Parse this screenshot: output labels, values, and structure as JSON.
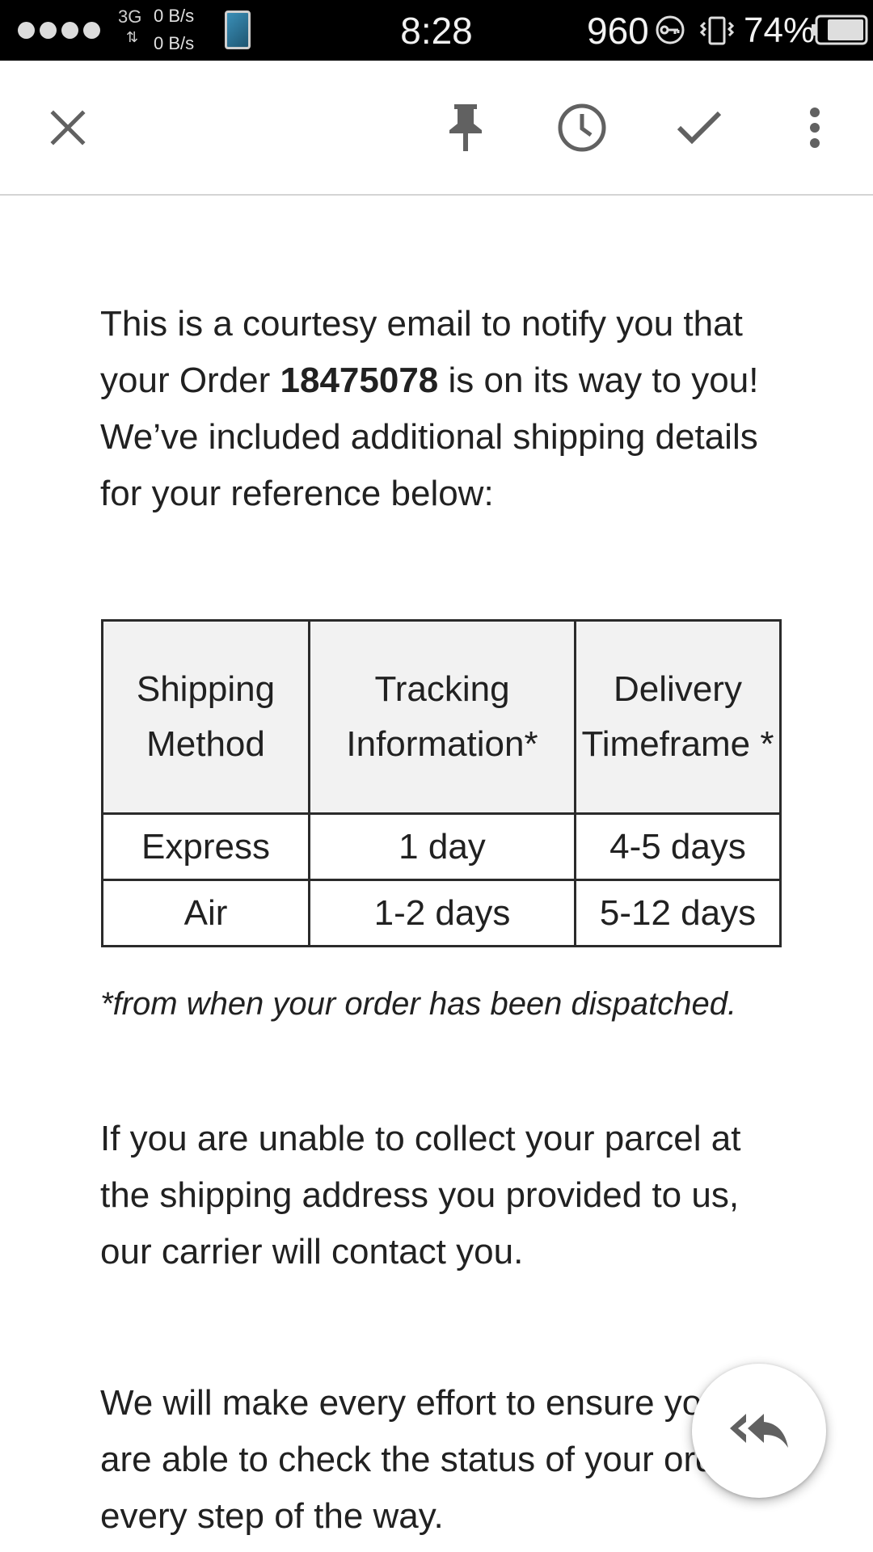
{
  "status_bar": {
    "network_type": "3G",
    "speed_up": "0 B/s",
    "speed_down": "0 B/s",
    "time": "8:28",
    "carrier_number": "960",
    "battery_percent": "74%"
  },
  "toolbar": {
    "close_icon": "close-icon",
    "pin_icon": "pin-icon",
    "snooze_icon": "clock-icon",
    "done_icon": "check-icon",
    "more_icon": "more-vert-icon"
  },
  "email": {
    "intro_part1": "This is a courtesy email to notify you that your Order ",
    "order_number": "18475078",
    "intro_part2": " is on its way to you!",
    "intro_line2": "We’ve included additional shipping details for your reference below:",
    "table": {
      "headers": [
        "Shipping Method",
        "Tracking Information*",
        "Delivery Timeframe *"
      ],
      "rows": [
        [
          "Express",
          "1 day",
          "4-5 days"
        ],
        [
          "Air",
          "1-2 days",
          "5-12 days"
        ]
      ]
    },
    "footnote": "*from when your order has been dispatched.",
    "collect_paragraph": "If you are unable to collect your parcel at the shipping address you provided to us, our carrier will contact you.",
    "effort_paragraph": "We will make every effort to ensure you are able to check the status of your order every step of the way."
  },
  "fab": {
    "icon": "reply-all-icon"
  },
  "colors": {
    "status_bar_bg": "#000000",
    "text": "#212121",
    "icon_gray": "#616161",
    "table_header_bg": "#f2f2f2"
  }
}
